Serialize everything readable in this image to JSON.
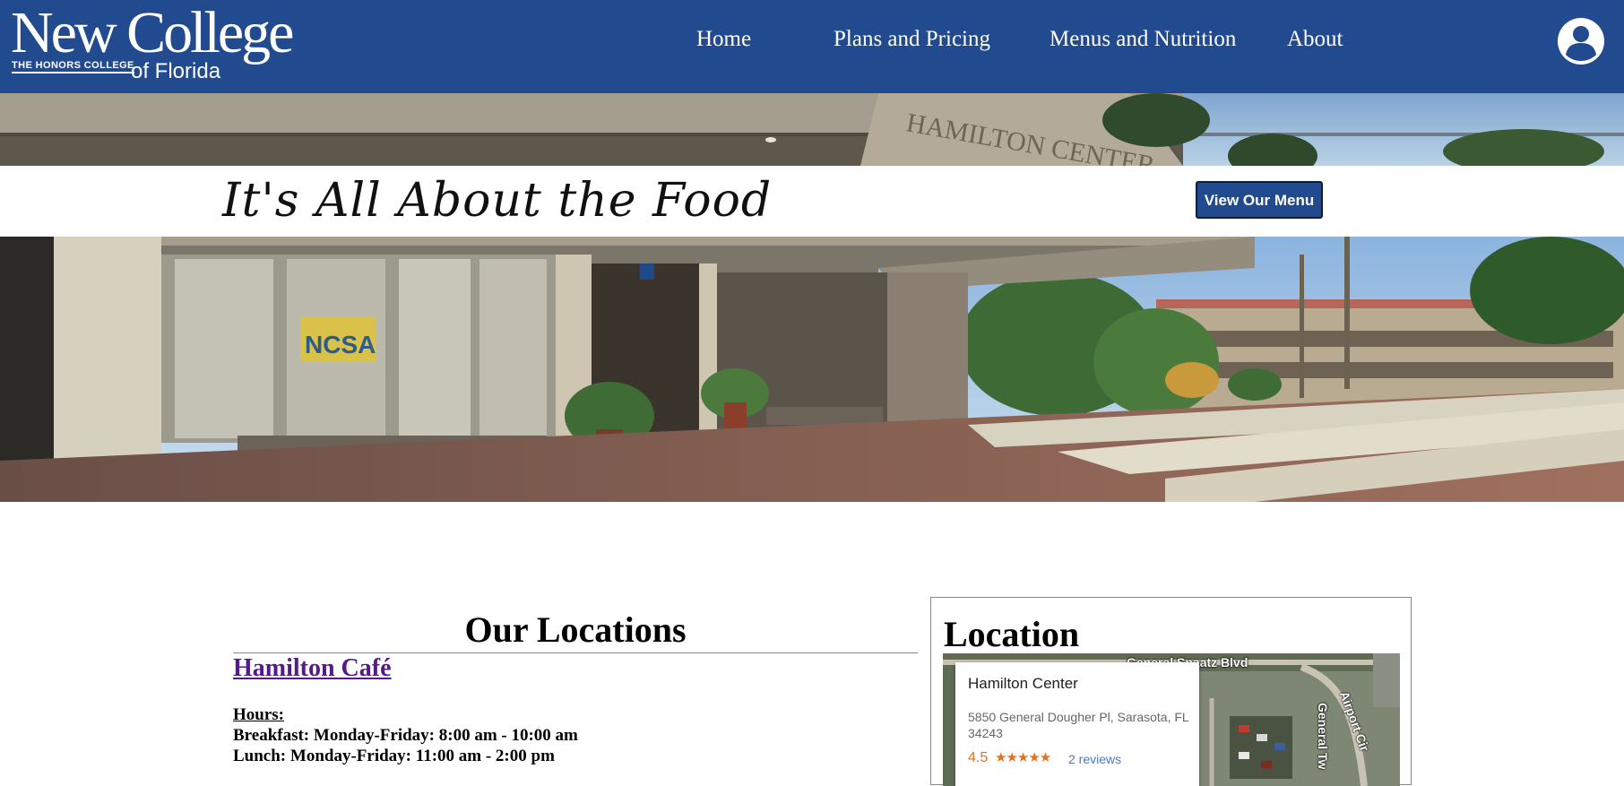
{
  "header": {
    "logo_main": "New College",
    "logo_sub": "THE HONORS COLLEGE",
    "logo_florida": "of Florida",
    "nav": [
      {
        "label": "Home"
      },
      {
        "label": "Plans and Pricing"
      },
      {
        "label": "Menus and Nutrition"
      },
      {
        "label": "About"
      }
    ],
    "colors": {
      "bar": "#224a8f",
      "text": "#ffffff"
    },
    "account_icon": "user-account-icon"
  },
  "hero": {
    "tagline": "It's All About the Food",
    "menu_button": "View Our Menu",
    "building_sign": "HAMILTON CENTER",
    "window_sign": "NCSA"
  },
  "locations": {
    "heading": "Our Locations",
    "cafe_name": "Hamilton Café",
    "hours_label": "Hours:",
    "hours": [
      "Breakfast: Monday-Friday: 8:00 am - 10:00 am",
      "Lunch: Monday-Friday: 11:00 am - 2:00 pm"
    ]
  },
  "map_card": {
    "heading": "Location",
    "place_name": "Hamilton Center",
    "address": "5850 General Dougher Pl, Sarasota, FL 34243",
    "rating": "4.5",
    "stars": "★★★★★",
    "reviews": "2 reviews",
    "roads": [
      "General Spaatz Blvd",
      "Airport Cir",
      "General Tw"
    ]
  }
}
